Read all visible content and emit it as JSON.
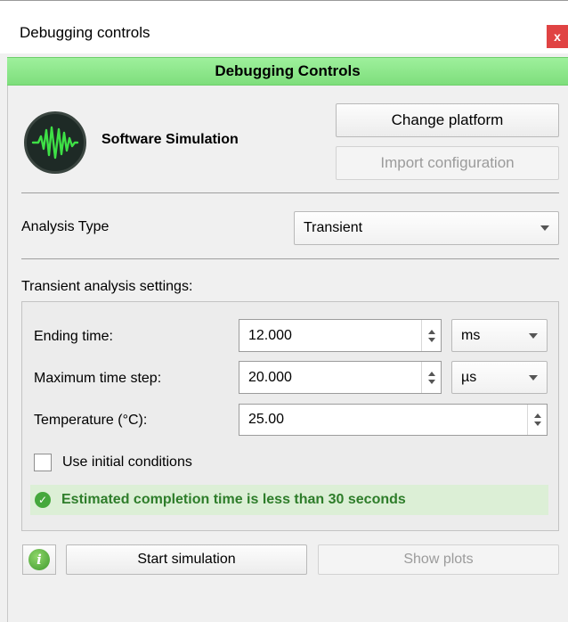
{
  "window": {
    "title": "Debugging controls",
    "close_glyph": "x"
  },
  "header": {
    "title": "Debugging Controls"
  },
  "platform": {
    "icon": "waveform-icon",
    "name": "Software Simulation",
    "change_label": "Change platform",
    "import_label": "Import configuration"
  },
  "analysis": {
    "label": "Analysis Type",
    "selected": "Transient"
  },
  "transient": {
    "heading": "Transient analysis settings:",
    "ending_time": {
      "label": "Ending time:",
      "value": "12.000",
      "unit": "ms"
    },
    "max_step": {
      "label": "Maximum time step:",
      "value": "20.000",
      "unit": "µs"
    },
    "temperature": {
      "label": "Temperature (°C):",
      "value": "25.00"
    },
    "initial_conditions": {
      "label": "Use initial conditions",
      "checked": false
    },
    "status": {
      "icon": "check-circle-icon",
      "text": "Estimated completion time is less than 30 seconds"
    }
  },
  "actions": {
    "info_icon": "info-icon",
    "start_label": "Start simulation",
    "plots_label": "Show plots"
  },
  "colors": {
    "accent_green": "#7ede7c",
    "status_text": "#2e7d2a",
    "close_red": "#e04343"
  }
}
